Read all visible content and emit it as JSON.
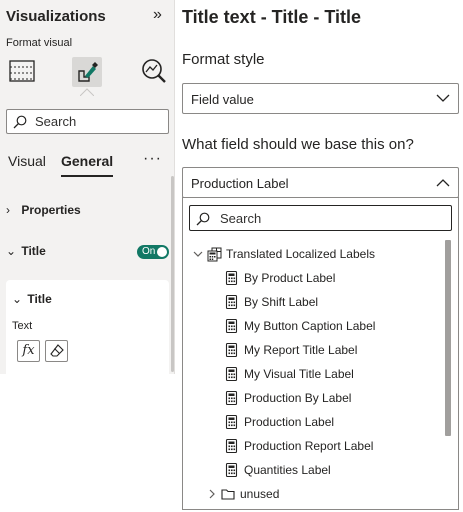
{
  "pane": {
    "title": "Visualizations",
    "format_visual_label": "Format visual",
    "search_placeholder": "Search",
    "tabs": [
      {
        "label": "Visual",
        "active": false
      },
      {
        "label": "General",
        "active": true
      }
    ],
    "more_label": "···",
    "sections": {
      "properties": "Properties",
      "title": "Title",
      "title_toggle": "On"
    },
    "card": {
      "title": "Title",
      "text_label": "Text",
      "fx_label": "fx"
    }
  },
  "main": {
    "page_title": "Title text - Title - Title",
    "format_style_label": "Format style",
    "format_style_value": "Field value",
    "field_question": "What field should we base this on?",
    "field_value": "Production Label",
    "dropdown": {
      "search_placeholder": "Search",
      "table_name": "Translated Localized Labels",
      "items": [
        "By Product Label",
        "By Shift Label",
        "My Button Caption Label",
        "My Report Title Label",
        "My Visual Title Label",
        "Production By Label",
        "Production Label",
        "Production Report Label",
        "Quantities Label"
      ],
      "folder_name": "unused"
    }
  },
  "colors": {
    "toggle_on": "#117865",
    "pane_bg": "#f3f2f1",
    "border": "#8a8886",
    "text": "#252423"
  }
}
